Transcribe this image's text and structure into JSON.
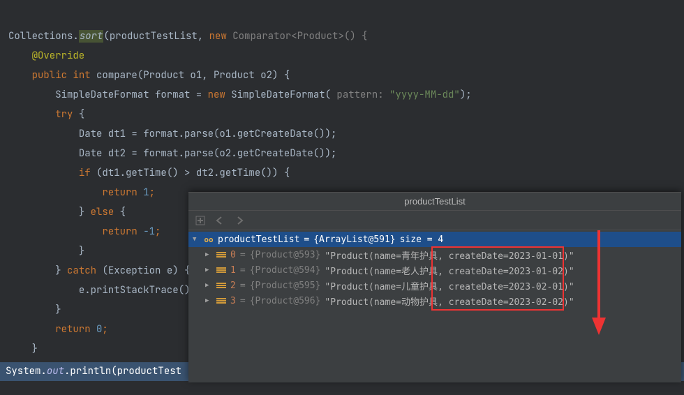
{
  "code": {
    "l1": {
      "a": "Collections.",
      "b": "sort",
      "c": "(productTestList",
      "d": ", ",
      "e": "new ",
      "f": "Comparator<Product>() {"
    },
    "l2": {
      "a": "@Override"
    },
    "l3": {
      "a": "public ",
      "b": "int ",
      "c": "compare(Product o1, Product o2) {"
    },
    "l4": {
      "a": "SimpleDateFormat format = ",
      "b": "new ",
      "c": "SimpleDateFormat( ",
      "hint": "pattern: ",
      "str": "\"yyyy-MM-dd\"",
      "e": ");"
    },
    "l5": {
      "a": "try ",
      "b": "{"
    },
    "l6": {
      "a": "Date dt1 = format.parse(o1.getCreateDate());"
    },
    "l7": {
      "a": "Date dt2 = format.parse(o2.getCreateDate());"
    },
    "l8": {
      "a": "if ",
      "b": "(dt1.getTime() > dt2.getTime()) {"
    },
    "l9": {
      "a": "return ",
      "b": "1",
      "c": ";"
    },
    "l10": {
      "a": "} ",
      "b": "else ",
      "c": "{"
    },
    "l11": {
      "a": "return ",
      "b": "-1",
      "c": ";"
    },
    "l12": {
      "a": "}"
    },
    "l13": {
      "a": "} ",
      "b": "catch ",
      "c": "(Exception e) {"
    },
    "l14": {
      "a": "e.printStackTrace();"
    },
    "l15": {
      "a": "}"
    },
    "l16": {
      "a": "return ",
      "b": "0",
      "c": ";"
    },
    "l17": {
      "a": "}"
    },
    "l18": {
      "a": "});"
    }
  },
  "bottom": {
    "a": "System.",
    "b": "out",
    "c": ".println(productTest"
  },
  "debugger": {
    "title": "productTestList",
    "root": {
      "icon": "oo",
      "name": "productTestList",
      "eq": " = ",
      "obj": "{ArrayList@591}",
      "size_lbl": "  size = 4"
    },
    "items": [
      {
        "idx": "0",
        "obj": "{Product@593}",
        "val": "\"Product(name=青年护具, createDate=2023-01-01)\""
      },
      {
        "idx": "1",
        "obj": "{Product@594}",
        "val": "\"Product(name=老人护具, createDate=2023-01-02)\""
      },
      {
        "idx": "2",
        "obj": "{Product@595}",
        "val": "\"Product(name=儿童护具, createDate=2023-02-01)\""
      },
      {
        "idx": "3",
        "obj": "{Product@596}",
        "val": "\"Product(name=动物护具, createDate=2023-02-02)\""
      }
    ],
    "eq": " = "
  }
}
